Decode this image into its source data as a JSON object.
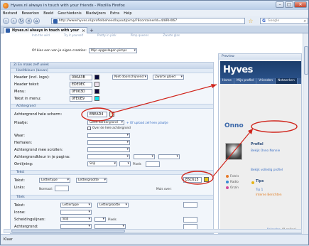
{
  "window": {
    "title": "Hyves.nl always in touch with your friends - Mozilla Firefox"
  },
  "menubar": {
    "items": [
      "Bestand",
      "Bewerken",
      "Beeld",
      "Geschiedenis",
      "Bladwijzers",
      "Extra",
      "Help"
    ]
  },
  "navbar": {
    "url": "http://www.hyves.nl/profielbeheer/layout/pimp/?8containerId=4/8RH067",
    "search_placeholder": "Google"
  },
  "tab": {
    "label": "Hyves.nl always in touch with your fr..."
  },
  "top_tabs": [
    "Into the wild",
    "Try it yourself",
    "Pretty in pink",
    "Pimp queens",
    "Zwarte glas"
  ],
  "pimp_choice": {
    "label": "Of kies een van je eigen creaties:",
    "select_value": "Mijn opgeslagen pimps"
  },
  "panel": {
    "header": "2) En maak zelf uniek",
    "sections": {
      "main_colors": "Hoofdkleurs (bovan)",
      "background": "Achtergrond",
      "text": "Tekst",
      "titles": "Titels"
    }
  },
  "main_colors": [
    {
      "label": "Header (incl. logo):",
      "value": "090A3B",
      "color": "#090A3B",
      "opt1": "Niet doorschijnend",
      "opt2": "Zwarte gloed"
    },
    {
      "label": "Header tekst:",
      "value": "EDE0EC",
      "color": "#EDE0EC"
    },
    {
      "label": "Menu:",
      "value": "0F063D",
      "color": "#0F063D"
    },
    {
      "label": "Tekst in menu:",
      "value": "0FE0E9",
      "color": "#0FE0E9"
    }
  ],
  "background": {
    "whole_screen": {
      "label": "Achtergrond hele scherm:",
      "value": "EBEAD4",
      "color": "#EBEAD4"
    },
    "image": {
      "label": "Plaatje:",
      "select": "Geen achtergrond",
      "upload_link": "+ Of upload zelf een plaatje"
    },
    "over_whole": "Over de hele achtergrond",
    "where": {
      "label": "Waar:"
    },
    "repeat": {
      "label": "Herhalen:"
    },
    "scroll": {
      "label": "Achtergrond mee scrollen:"
    },
    "page_bg": {
      "label": "Achtergrondkleur in je pagina:"
    },
    "border": {
      "label": "Omlijning:",
      "style": "Stijl",
      "size_label": "Pixels"
    }
  },
  "text_section": {
    "text": {
      "label": "Tekst:",
      "font": "Lettertype",
      "size": "Lettergrootte",
      "value": "E6C615",
      "color": "#E6C615"
    },
    "links": {
      "label": "Links:",
      "normal": "Normaal:",
      "hover": "Muis over:"
    }
  },
  "titles_section": {
    "text": {
      "label": "Tekst:",
      "font": "Lettertype",
      "size": "Lettergrootte"
    },
    "icons": {
      "label": "Icone:"
    },
    "dividers": {
      "label": "Scheidingslijnen:",
      "style": "Stijl",
      "size_label": "Pixels"
    },
    "background": {
      "label": "Achtergrond:"
    }
  },
  "preview": {
    "header": "Preview",
    "logo": "Hyves",
    "nav": [
      "Home",
      "Mijn profiel",
      "Vrienden",
      "Netwerken"
    ],
    "name": "Onno",
    "profile_title": "Profiel",
    "profile_link": "Bekijk Onno Nonnie",
    "profile_sub": "Bekijk volledig profiel",
    "side_items": [
      "Foto's",
      "Radio",
      "Onzin"
    ],
    "tips_title": "Tips",
    "tips_items": [
      "Tip 1",
      "Interne Berichten"
    ],
    "bottom_link": "Vrienden",
    "bottom_count": "(0 online)"
  },
  "status": {
    "text": "Klaar"
  },
  "annotation": {
    "color": "#d0241b"
  }
}
